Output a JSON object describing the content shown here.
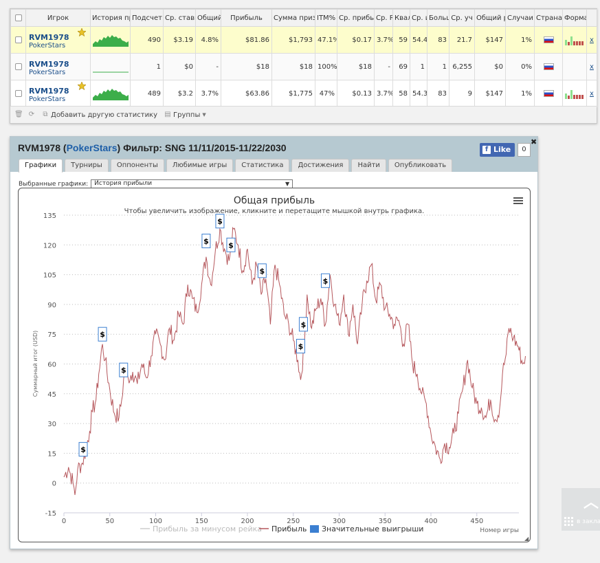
{
  "table": {
    "headers": [
      "",
      "Игрок",
      "История пр",
      "Подсчет",
      "Ср. ставк",
      "Общий",
      "Прибыль",
      "Сумма приз",
      "ITM%",
      "Ср. прибы",
      "Ср. R",
      "Квал",
      "Ср. и",
      "Больш",
      "Ср. уч",
      "Общий р",
      "Случаи",
      "Страна",
      "Форма",
      ""
    ],
    "rows": [
      {
        "name": "RVM1978",
        "site": "PokerStars",
        "highlight": true,
        "count": "490",
        "avg_stake": "$3.19",
        "total": "4.8%",
        "profit": "$81.86",
        "prize_sum": "$1,793",
        "itm": "47.1%",
        "avg_profit": "$0.17",
        "avg_r": "3.7%",
        "qual": "59",
        "avg_i": "54.4",
        "big": "83",
        "avg_part": "21.7",
        "total_r": "$147",
        "cases": "1%",
        "remove": "x",
        "spark": "hill",
        "form": [
          0.5,
          0.2,
          1,
          0.3,
          0.3,
          0.3,
          0.3
        ]
      },
      {
        "name": "RVM1978",
        "site": "PokerStars",
        "highlight": false,
        "count": "1",
        "avg_stake": "$0",
        "total": "-",
        "profit": "$18",
        "prize_sum": "$18",
        "itm": "100%",
        "avg_profit": "$18",
        "avg_r": "-",
        "qual": "69",
        "avg_i": "1",
        "big": "1",
        "avg_part": "6,255",
        "total_r": "$0",
        "cases": "0%",
        "remove": "x",
        "spark": "flat",
        "form": []
      },
      {
        "name": "RVM1978",
        "site": "PokerStars",
        "highlight": false,
        "count": "489",
        "avg_stake": "$3.2",
        "total": "3.7%",
        "profit": "$63.86",
        "prize_sum": "$1,775",
        "itm": "47%",
        "avg_profit": "$0.13",
        "avg_r": "3.7%",
        "qual": "58",
        "avg_i": "54.3",
        "big": "83",
        "avg_part": "9",
        "total_r": "$147",
        "cases": "1%",
        "remove": "x",
        "spark": "hill",
        "form": [
          0.5,
          0.2,
          1,
          0.3,
          0.3,
          0.3,
          0.3
        ]
      }
    ],
    "footer": {
      "add_stat": "Добавить другую статистику",
      "groups": "Группы"
    }
  },
  "panel": {
    "player": "RVM1978",
    "site": "PokerStars",
    "filter_label": "Фильтр:",
    "filter_value": "SNG 11/11/2015-11/22/2030",
    "fb_like": "Like",
    "fb_count": "0",
    "tabs": [
      "Графики",
      "Турниры",
      "Оппоненты",
      "Любимые игры",
      "Статистика",
      "Достижения",
      "Найти",
      "Опубликовать"
    ],
    "selected_chart_label": "Выбранные графики:",
    "selected_chart_value": "История прибыли"
  },
  "chart_data": {
    "type": "line",
    "title": "Общая прибыль",
    "subtitle": "Чтобы увеличить изображение, кликните и перетащите мышкой внутрь графика.",
    "ylabel": "Суммарный итог (USD)",
    "xlabel": "Номер игры",
    "ylim": [
      -15,
      135
    ],
    "xlim": [
      0,
      490
    ],
    "yticks": [
      -15,
      0,
      15,
      30,
      45,
      60,
      75,
      90,
      105,
      120,
      135
    ],
    "xticks": [
      0,
      50,
      100,
      150,
      200,
      250,
      300,
      350,
      400,
      450
    ],
    "grid": true,
    "legend": {
      "position": "bottom",
      "items": [
        "Прибыль за минусом рейка",
        "Прибыль",
        "Значительные выигрыши"
      ]
    },
    "colors": {
      "rake": "#cccccc",
      "profit": "#b5565b",
      "big_wins": "#3b7fd1"
    },
    "anchors": [
      [
        0,
        3
      ],
      [
        5,
        8
      ],
      [
        10,
        0
      ],
      [
        12,
        -6
      ],
      [
        15,
        7
      ],
      [
        20,
        10
      ],
      [
        24,
        17
      ],
      [
        28,
        26
      ],
      [
        31,
        36
      ],
      [
        35,
        42
      ],
      [
        38,
        55
      ],
      [
        42,
        70
      ],
      [
        45,
        62
      ],
      [
        50,
        47
      ],
      [
        55,
        35
      ],
      [
        60,
        33
      ],
      [
        63,
        42
      ],
      [
        66,
        56
      ],
      [
        70,
        53
      ],
      [
        75,
        56
      ],
      [
        80,
        50
      ],
      [
        85,
        60
      ],
      [
        90,
        53
      ],
      [
        95,
        64
      ],
      [
        100,
        75
      ],
      [
        105,
        70
      ],
      [
        110,
        62
      ],
      [
        115,
        78
      ],
      [
        120,
        72
      ],
      [
        125,
        85
      ],
      [
        130,
        80
      ],
      [
        135,
        100
      ],
      [
        140,
        93
      ],
      [
        145,
        86
      ],
      [
        150,
        100
      ],
      [
        155,
        114
      ],
      [
        160,
        100
      ],
      [
        165,
        117
      ],
      [
        170,
        128
      ],
      [
        175,
        118
      ],
      [
        180,
        112
      ],
      [
        185,
        128
      ],
      [
        190,
        120
      ],
      [
        195,
        107
      ],
      [
        200,
        118
      ],
      [
        205,
        100
      ],
      [
        210,
        110
      ],
      [
        215,
        95
      ],
      [
        220,
        103
      ],
      [
        225,
        80
      ],
      [
        230,
        110
      ],
      [
        235,
        100
      ],
      [
        240,
        85
      ],
      [
        245,
        80
      ],
      [
        250,
        72
      ],
      [
        255,
        62
      ],
      [
        258,
        52
      ],
      [
        262,
        70
      ],
      [
        265,
        95
      ],
      [
        270,
        78
      ],
      [
        275,
        88
      ],
      [
        280,
        93
      ],
      [
        285,
        80
      ],
      [
        290,
        105
      ],
      [
        295,
        90
      ],
      [
        300,
        80
      ],
      [
        305,
        95
      ],
      [
        310,
        75
      ],
      [
        315,
        90
      ],
      [
        320,
        70
      ],
      [
        325,
        90
      ],
      [
        330,
        102
      ],
      [
        335,
        110
      ],
      [
        340,
        92
      ],
      [
        345,
        100
      ],
      [
        350,
        88
      ],
      [
        355,
        85
      ],
      [
        360,
        80
      ],
      [
        365,
        82
      ],
      [
        370,
        70
      ],
      [
        375,
        80
      ],
      [
        380,
        60
      ],
      [
        385,
        55
      ],
      [
        390,
        45
      ],
      [
        395,
        40
      ],
      [
        400,
        25
      ],
      [
        405,
        18
      ],
      [
        410,
        12
      ],
      [
        415,
        20
      ],
      [
        420,
        18
      ],
      [
        425,
        25
      ],
      [
        430,
        35
      ],
      [
        435,
        48
      ],
      [
        440,
        62
      ],
      [
        445,
        48
      ],
      [
        450,
        40
      ],
      [
        455,
        38
      ],
      [
        460,
        33
      ],
      [
        465,
        42
      ],
      [
        470,
        32
      ],
      [
        475,
        38
      ],
      [
        478,
        55
      ],
      [
        482,
        65
      ],
      [
        485,
        78
      ],
      [
        490,
        73
      ],
      [
        495,
        69
      ],
      [
        500,
        60
      ],
      [
        503,
        64
      ]
    ],
    "big_wins": [
      [
        21,
        17
      ],
      [
        42,
        75
      ],
      [
        65,
        57
      ],
      [
        155,
        122
      ],
      [
        170,
        132
      ],
      [
        182,
        120
      ],
      [
        216,
        107
      ],
      [
        258,
        69
      ],
      [
        261,
        80
      ],
      [
        285,
        102
      ]
    ]
  },
  "sidebar_widget": {
    "apps_label": "в закла"
  }
}
